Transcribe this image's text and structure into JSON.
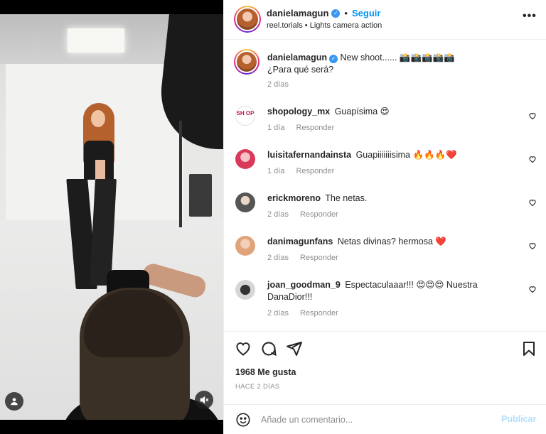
{
  "post": {
    "username": "danielamagun",
    "follow_label": "Seguir",
    "separator": "•",
    "audio": "reel.torials • Lights camera action",
    "more_label": "•••"
  },
  "caption": {
    "username": "danielamagun",
    "text": "New shoot...... 📸📸📸📸📸",
    "text2": "¿Para qué será?",
    "time": "2 días"
  },
  "comments": [
    {
      "username": "shopology_mx",
      "text": "Guapísima 😍",
      "time": "1 día",
      "reply": "Responder",
      "avatar_text": "SH OP"
    },
    {
      "username": "luisitafernandainsta",
      "text": "Guapiiiiiiisima 🔥🔥🔥❤️",
      "time": "1 día",
      "reply": "Responder"
    },
    {
      "username": "erickmoreno",
      "text": "The netas.",
      "time": "2 días",
      "reply": "Responder"
    },
    {
      "username": "danimagunfans",
      "text": "Netas divinas? hermosa ❤️",
      "time": "2 días",
      "reply": "Responder"
    },
    {
      "username": "joan_goodman_9",
      "text": "Espectaculaaar!!! 😍😍😍 Nuestra DanaDior!!!",
      "time": "2 días",
      "reply": "Responder"
    }
  ],
  "stats": {
    "likes": "1968 Me gusta",
    "posted": "HACE 2 DÍAS"
  },
  "composer": {
    "placeholder": "Añade un comentario...",
    "publish_label": "Publicar"
  },
  "icons": {
    "like": "heart-icon",
    "comment": "comment-icon",
    "share": "share-icon",
    "save": "bookmark-icon",
    "emoji": "emoji-icon",
    "mute": "speaker-muted-icon",
    "tagged": "user-tag-icon"
  },
  "colors": {
    "accent": "#0095f6",
    "verified": "#3897f0",
    "muted_text": "#8e8e8e",
    "publish_disabled": "#b2dffc"
  }
}
